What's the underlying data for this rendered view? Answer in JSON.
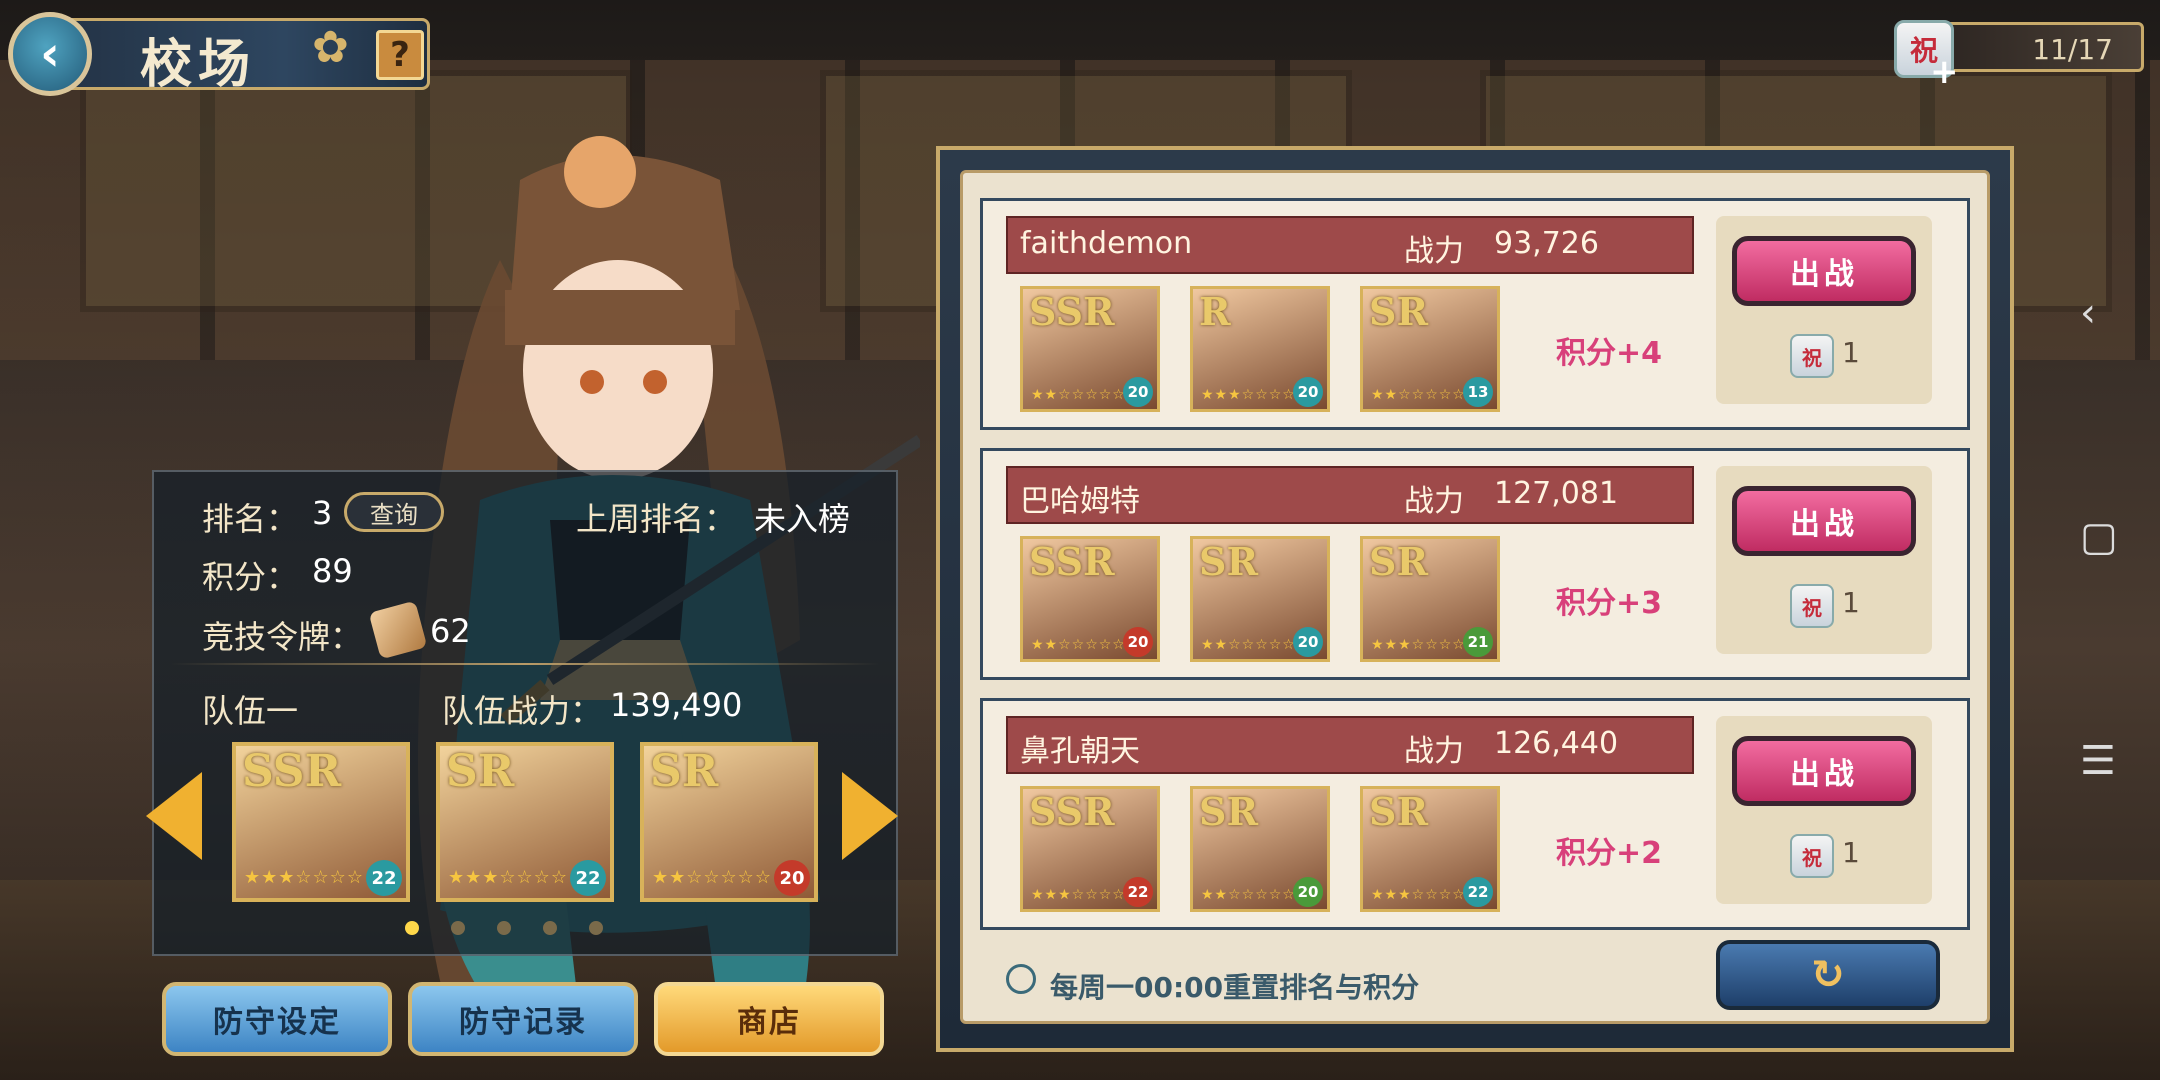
{
  "header": {
    "title": "校场",
    "back_icon": "‹",
    "help_label": "?"
  },
  "ticket": {
    "icon_label": "祝",
    "count": "11/17",
    "plus": "+"
  },
  "info": {
    "rank_label": "排名：",
    "rank_value": "3",
    "query_label": "查询",
    "last_week_label": "上周排名：",
    "last_week_value": "未入榜",
    "score_label": "积分：",
    "score_value": "89",
    "token_label": "竞技令牌：",
    "token_value": "62",
    "team_label": "队伍一",
    "team_power_label": "队伍战力：",
    "team_power_value": "139,490"
  },
  "team_cards": [
    {
      "rarity": "SSR",
      "stars": "★★★☆☆☆☆",
      "level": "22",
      "element": "water"
    },
    {
      "rarity": "SR",
      "stars": "★★★☆☆☆☆",
      "level": "22",
      "element": "water"
    },
    {
      "rarity": "SR",
      "stars": "★★☆☆☆☆☆",
      "level": "20",
      "element": "fire"
    }
  ],
  "page_dots": 5,
  "bottom_buttons": {
    "defense_set": "防守设定",
    "defense_log": "防守记录",
    "shop": "商店"
  },
  "opponents": [
    {
      "name": "faithdemon",
      "power_label": "战力",
      "power": "93,726",
      "score": "积分+4",
      "battle_label": "出战",
      "cost": "1",
      "cards": [
        {
          "rarity": "SSR",
          "stars": "★★☆☆☆☆☆",
          "level": "20",
          "element": "water"
        },
        {
          "rarity": "R",
          "stars": "★★★☆☆☆☆",
          "level": "20",
          "element": "water"
        },
        {
          "rarity": "SR",
          "stars": "★★☆☆☆☆☆",
          "level": "13",
          "element": "water"
        }
      ]
    },
    {
      "name": "巴哈姆特",
      "power_label": "战力",
      "power": "127,081",
      "score": "积分+3",
      "battle_label": "出战",
      "cost": "1",
      "cards": [
        {
          "rarity": "SSR",
          "stars": "★★☆☆☆☆☆",
          "level": "20",
          "element": "fire"
        },
        {
          "rarity": "SR",
          "stars": "★★☆☆☆☆☆",
          "level": "20",
          "element": "water"
        },
        {
          "rarity": "SR",
          "stars": "★★★☆☆☆☆",
          "level": "21",
          "element": "leaf"
        }
      ]
    },
    {
      "name": "鼻孔朝天",
      "power_label": "战力",
      "power": "126,440",
      "score": "积分+2",
      "battle_label": "出战",
      "cost": "1",
      "cards": [
        {
          "rarity": "SSR",
          "stars": "★★★☆☆☆☆",
          "level": "22",
          "element": "fire"
        },
        {
          "rarity": "SR",
          "stars": "★★☆☆☆☆☆",
          "level": "20",
          "element": "leaf"
        },
        {
          "rarity": "SR",
          "stars": "★★★☆☆☆☆",
          "level": "22",
          "element": "water"
        }
      ]
    }
  ],
  "reset_note": "每周一00:00重置排名与积分",
  "refresh_icon": "↻",
  "nav": {
    "back": "‹",
    "home": "▢",
    "menu": "☰"
  },
  "colors": {
    "accent_gold": "#c8aa6a",
    "battle_pink": "#e04b86",
    "score_pink": "#d8407a",
    "name_bar": "#9e4a4a"
  }
}
